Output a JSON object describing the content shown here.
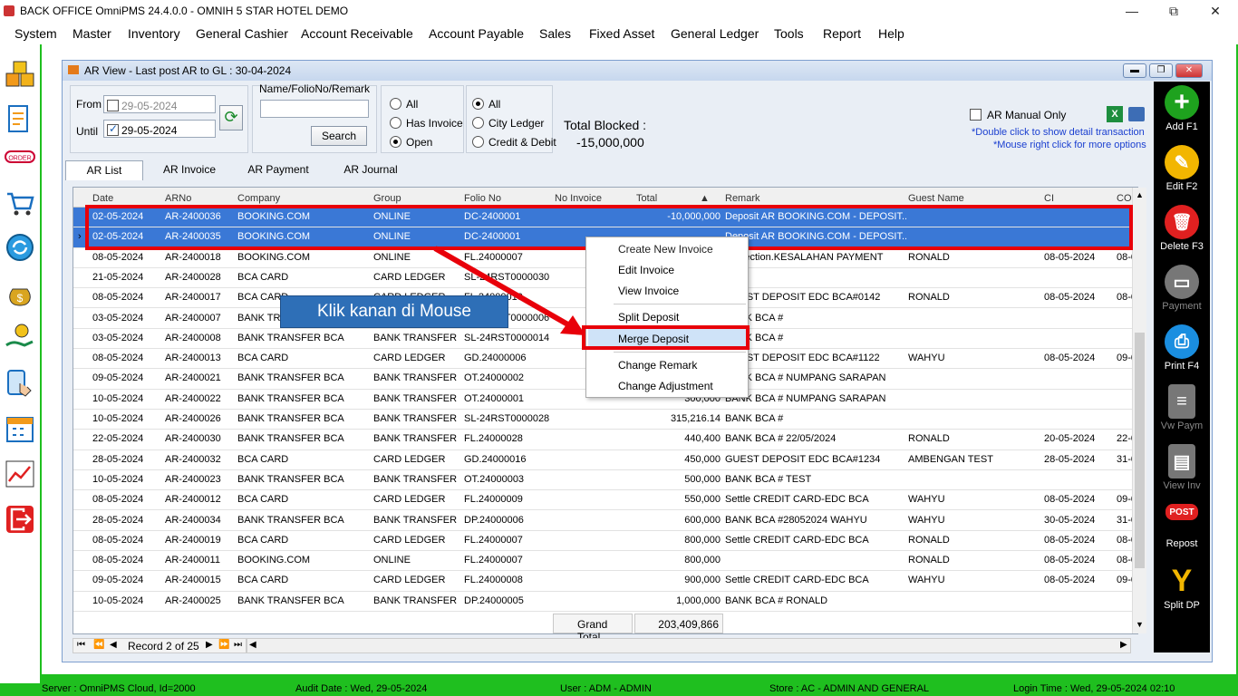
{
  "window": {
    "title": "BACK OFFICE OmniPMS 24.4.0.0 - OMNIH 5 STAR HOTEL DEMO",
    "min": "—",
    "max": "⧉",
    "close": "✕"
  },
  "menu": [
    "System",
    "Master",
    "Inventory",
    "General Cashier",
    "Account Receivable",
    "Account Payable",
    "Sales",
    "Fixed Asset",
    "General Ledger",
    "Tools",
    "Report",
    "Help"
  ],
  "child": {
    "title": "AR View - Last post AR to GL : 30-04-2024"
  },
  "filters": {
    "from_label": "From",
    "until_label": "Until",
    "from_date": "29-05-2024",
    "until_date": "29-05-2024",
    "name_label": "Name/FolioNo/Remark",
    "search": "Search",
    "group1": [
      "All",
      "Has Invoice",
      "Open"
    ],
    "group2": [
      "All",
      "City Ledger",
      "Credit & Debit"
    ],
    "blocked_label": "Total Blocked :",
    "blocked_value": "-15,000,000",
    "manual_only": "AR Manual Only",
    "hint1": "*Double click to show detail transaction",
    "hint2": "*Mouse right click for more options"
  },
  "tabs": [
    "AR List",
    "AR Invoice",
    "AR Payment",
    "AR Journal"
  ],
  "columns": [
    "Date",
    "ARNo",
    "Company",
    "Group",
    "Folio No",
    "No Invoice",
    "Total",
    "Remark",
    "Guest Name",
    "CI",
    "CO"
  ],
  "rows": [
    [
      "02-05-2024",
      "AR-2400036",
      "BOOKING.COM",
      "ONLINE",
      "DC-2400001",
      "",
      "-10,000,000",
      "Deposit AR BOOKING.COM - DEPOSIT...",
      "",
      "",
      ""
    ],
    [
      "02-05-2024",
      "AR-2400035",
      "BOOKING.COM",
      "ONLINE",
      "DC-2400001",
      "",
      "",
      "Deposit AR BOOKING.COM - DEPOSIT...",
      "",
      "",
      ""
    ],
    [
      "08-05-2024",
      "AR-2400018",
      "BOOKING.COM",
      "ONLINE",
      "FL.24000007",
      "",
      "",
      "Correction.KESALAHAN PAYMENT",
      "RONALD",
      "08-05-2024",
      "08-0"
    ],
    [
      "21-05-2024",
      "AR-2400028",
      "BCA CARD",
      "CARD LEDGER",
      "SL-24RST0000030",
      "",
      "",
      "",
      "",
      "",
      ""
    ],
    [
      "08-05-2024",
      "AR-2400017",
      "BCA CARD",
      "CARD LEDGER",
      "FL.24000010",
      "",
      "",
      "GUEST DEPOSIT EDC BCA#0142",
      "RONALD",
      "08-05-2024",
      "08-0"
    ],
    [
      "03-05-2024",
      "AR-2400007",
      "BANK TRANSFER BCA",
      "BANK TRANSFER",
      "SL-24RST0000006",
      "",
      "",
      "BANK BCA #",
      "",
      "",
      ""
    ],
    [
      "03-05-2024",
      "AR-2400008",
      "BANK TRANSFER BCA",
      "BANK TRANSFER",
      "SL-24RST0000014",
      "",
      "",
      "BANK BCA #",
      "",
      "",
      ""
    ],
    [
      "08-05-2024",
      "AR-2400013",
      "BCA CARD",
      "CARD LEDGER",
      "GD.24000006",
      "",
      "",
      "GUEST DEPOSIT EDC BCA#1122",
      "WAHYU",
      "08-05-2024",
      "09-0"
    ],
    [
      "09-05-2024",
      "AR-2400021",
      "BANK TRANSFER BCA",
      "BANK TRANSFER",
      "OT.24000002",
      "",
      "",
      "BANK BCA # NUMPANG SARAPAN",
      "",
      "",
      ""
    ],
    [
      "10-05-2024",
      "AR-2400022",
      "BANK TRANSFER BCA",
      "BANK TRANSFER",
      "OT.24000001",
      "",
      "300,000",
      "BANK BCA # NUMPANG SARAPAN",
      "",
      "",
      ""
    ],
    [
      "10-05-2024",
      "AR-2400026",
      "BANK TRANSFER BCA",
      "BANK TRANSFER",
      "SL-24RST0000028",
      "",
      "315,216.14",
      "BANK BCA #",
      "",
      "",
      ""
    ],
    [
      "22-05-2024",
      "AR-2400030",
      "BANK TRANSFER BCA",
      "BANK TRANSFER",
      "FL.24000028",
      "",
      "440,400",
      "BANK BCA # 22/05/2024",
      "RONALD",
      "20-05-2024",
      "22-0"
    ],
    [
      "28-05-2024",
      "AR-2400032",
      "BCA CARD",
      "CARD LEDGER",
      "GD.24000016",
      "",
      "450,000",
      "GUEST DEPOSIT EDC BCA#1234",
      "AMBENGAN TEST",
      "28-05-2024",
      "31-0"
    ],
    [
      "10-05-2024",
      "AR-2400023",
      "BANK TRANSFER BCA",
      "BANK TRANSFER",
      "OT.24000003",
      "",
      "500,000",
      "BANK BCA # TEST",
      "",
      "",
      ""
    ],
    [
      "08-05-2024",
      "AR-2400012",
      "BCA CARD",
      "CARD LEDGER",
      "FL.24000009",
      "",
      "550,000",
      "Settle CREDIT CARD-EDC BCA",
      "WAHYU",
      "08-05-2024",
      "09-0"
    ],
    [
      "28-05-2024",
      "AR-2400034",
      "BANK TRANSFER BCA",
      "BANK TRANSFER",
      "DP.24000006",
      "",
      "600,000",
      "BANK BCA #28052024 WAHYU",
      "WAHYU",
      "30-05-2024",
      "31-0"
    ],
    [
      "08-05-2024",
      "AR-2400019",
      "BCA CARD",
      "CARD LEDGER",
      "FL.24000007",
      "",
      "800,000",
      "Settle CREDIT CARD-EDC BCA",
      "RONALD",
      "08-05-2024",
      "08-0"
    ],
    [
      "08-05-2024",
      "AR-2400011",
      "BOOKING.COM",
      "ONLINE",
      "FL.24000007",
      "",
      "800,000",
      "",
      "RONALD",
      "08-05-2024",
      "08-0"
    ],
    [
      "09-05-2024",
      "AR-2400015",
      "BCA CARD",
      "CARD LEDGER",
      "FL.24000008",
      "",
      "900,000",
      "Settle CREDIT CARD-EDC BCA",
      "WAHYU",
      "08-05-2024",
      "09-0"
    ],
    [
      "10-05-2024",
      "AR-2400025",
      "BANK TRANSFER BCA",
      "BANK TRANSFER",
      "DP.24000005",
      "",
      "1,000,000",
      "BANK BCA # RONALD",
      "",
      "",
      ""
    ]
  ],
  "grand_total_label": "Grand Total",
  "grand_total_value": "203,409,866",
  "record_nav": "Record 2 of 25",
  "context_menu": [
    "Create New Invoice",
    "Edit Invoice",
    "View Invoice",
    "Split Deposit",
    "Merge Deposit",
    "Change Remark",
    "Change Adjustment"
  ],
  "callout": "Klik kanan di Mouse",
  "right_actions": [
    {
      "label": "Add F1",
      "icon": "+",
      "color": "#1ea21e"
    },
    {
      "label": "Edit F2",
      "icon": "✎",
      "color": "#f2b600"
    },
    {
      "label": "Delete F3",
      "icon": "🗑",
      "color": "#e02020"
    },
    {
      "label": "Payment",
      "icon": "▭",
      "color": "#777"
    },
    {
      "label": "Print F4",
      "icon": "⎙",
      "color": "#1a8ee0"
    },
    {
      "label": "Vw Paym",
      "icon": "≡",
      "color": "#777"
    },
    {
      "label": "View Inv",
      "icon": "▤",
      "color": "#777"
    },
    {
      "label": "Repost",
      "icon": "POST",
      "color": "#e02020"
    },
    {
      "label": "Split DP",
      "icon": "Y",
      "color": "#f2b600"
    }
  ],
  "status": {
    "server": "Server : OmniPMS Cloud, Id=2000",
    "audit": "Audit Date : Wed, 29-05-2024",
    "user": "User : ADM - ADMIN",
    "store": "Store : AC - ADMIN AND GENERAL",
    "login": "Login Time : Wed, 29-05-2024 02:10"
  },
  "colors": {
    "selection": "#3a78d6",
    "highlight": "#e8000a",
    "frame": "#1fbf1f",
    "callout": "#2e6fb7"
  }
}
